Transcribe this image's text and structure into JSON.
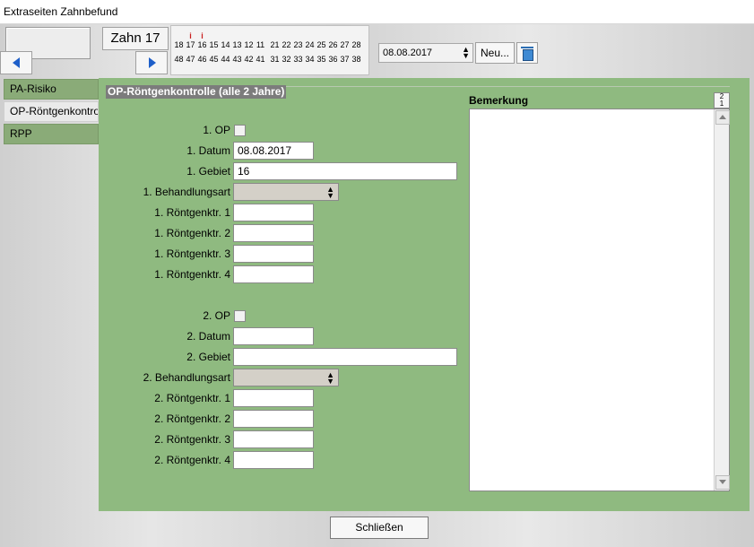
{
  "window": {
    "title": "Extraseiten Zahnbefund"
  },
  "toolbar": {
    "zahn_label": "Zahn 17",
    "date_value": "08.08.2017",
    "new_label": "Neu...",
    "upper_teeth": [
      "18",
      "17",
      "16",
      "15",
      "14",
      "13",
      "12",
      "11",
      "21",
      "22",
      "23",
      "24",
      "25",
      "26",
      "27",
      "28"
    ],
    "lower_teeth": [
      "48",
      "47",
      "46",
      "45",
      "44",
      "43",
      "42",
      "41",
      "31",
      "32",
      "33",
      "34",
      "35",
      "36",
      "37",
      "38"
    ],
    "marked_teeth": [
      "17",
      "16"
    ],
    "mark_symbol": "i"
  },
  "sidebar": {
    "items": [
      {
        "label": "PA-Risiko"
      },
      {
        "label": "OP-Röntgenkontrolle"
      },
      {
        "label": "RPP"
      }
    ]
  },
  "section": {
    "title": "OP-Röntgenkontrolle (alle 2 Jahre)"
  },
  "op1": {
    "op_label": "1. OP",
    "datum_label": "1. Datum",
    "datum_value": "08.08.2017",
    "gebiet_label": "1. Gebiet",
    "gebiet_value": "16",
    "behandlungsart_label": "1. Behandlungsart",
    "behandlungsart_value": "",
    "roentgen_labels": [
      "1. Röntgenktr. 1",
      "1. Röntgenktr. 2",
      "1. Röntgenktr. 3",
      "1. Röntgenktr. 4"
    ]
  },
  "op2": {
    "op_label": "2. OP",
    "datum_label": "2. Datum",
    "datum_value": "",
    "gebiet_label": "2. Gebiet",
    "gebiet_value": "",
    "behandlungsart_label": "2. Behandlungsart",
    "behandlungsart_value": "",
    "roentgen_labels": [
      "2. Röntgenktr. 1",
      "2. Röntgenktr. 2",
      "2. Röntgenktr. 3",
      "2. Röntgenktr. 4"
    ]
  },
  "bemerkung": {
    "label": "Bemerkung",
    "value": ""
  },
  "footer": {
    "close_label": "Schließen"
  },
  "colors": {
    "panel": "#8fba80",
    "accent": "#1e5fc9",
    "mark": "#c81e1e"
  }
}
